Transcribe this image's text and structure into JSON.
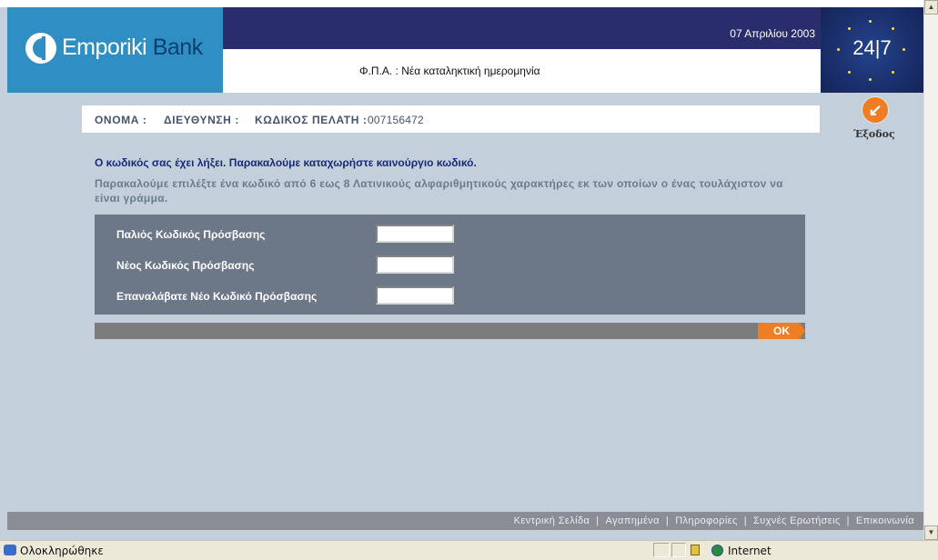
{
  "header": {
    "logo_word1": "Emporiki",
    "logo_word2": "Bank",
    "date": "07 Απριλίου 2003",
    "subtitle": "Φ.Π.Α. : Νέα καταληκτική ημερομηνία",
    "badge": "24|7"
  },
  "client": {
    "name_label": "ΟΝΟΜΑ :",
    "address_label": "ΔΙΕΥΘΥΝΣΗ :",
    "code_label": "ΚΩΔΙΚΟΣ ΠΕΛΑΤΗ :",
    "code_value": "007156472"
  },
  "exit": {
    "label": "Έξοδος",
    "icon": "arrow-down-left-icon"
  },
  "messages": {
    "expired": "Ο κωδικός σας έχει λήξει. Παρακαλούμε καταχωρήστε καινούργιο κωδικό.",
    "instructions": "Παρακαλούμε επιλέξτε ένα κωδικό από 6 εως 8 Λατινικούς αλφαριθμητικούς χαρακτήρες εκ των οποίων ο ένας τουλάχιστον να είναι γράμμα."
  },
  "form": {
    "old_password_label": "Παλιός Κωδικός Πρόσβασης",
    "new_password_label": "Νέος Κωδικός Πρόσβασης",
    "repeat_password_label": "Επαναλάβατε Νέο Κωδικό Πρόσβασης",
    "old_password_value": "",
    "new_password_value": "",
    "repeat_password_value": "",
    "ok_label": "OK"
  },
  "footer": {
    "links": [
      "Κεντρική Σελίδα",
      "Αγαπημένα",
      "Πληροφορίες",
      "Συχνές Ερωτήσεις",
      "Επικοινωνία"
    ],
    "separator": "|"
  },
  "statusbar": {
    "status": "Ολοκληρώθηκε",
    "zone": "Internet"
  },
  "colors": {
    "page_bg": "#c3d0db",
    "header_navy": "#2a2d6b",
    "logo_blue": "#2f8fc3",
    "accent_orange": "#ef7d23",
    "form_panel": "#6c7787",
    "footer_bar": "#8a8d94"
  }
}
